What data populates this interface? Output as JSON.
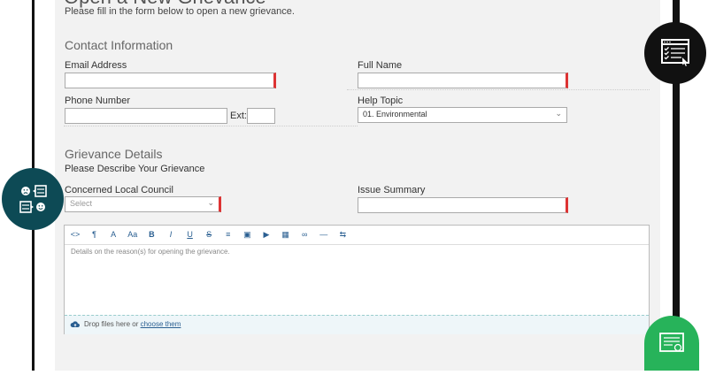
{
  "form": {
    "title": "Open a New Grievance",
    "subtitle": "Please fill in the form below to open a new grievance.",
    "contact_section": "Contact Information",
    "email_label": "Email Address",
    "fullname_label": "Full Name",
    "phone_label": "Phone Number",
    "ext_label": "Ext:",
    "help_topic_label": "Help Topic",
    "help_topic_value": "01. Environmental",
    "details_section": "Grievance Details",
    "details_prompt": "Please Describe Your Grievance",
    "council_label": "Concerned Local Council",
    "council_placeholder": "Select",
    "issue_label": "Issue Summary"
  },
  "editor": {
    "toolbar": [
      {
        "name": "code-view-icon",
        "glyph": "<>"
      },
      {
        "name": "paragraph-icon",
        "glyph": "¶"
      },
      {
        "name": "font-color-icon",
        "glyph": "A"
      },
      {
        "name": "font-size-icon",
        "glyph": "Aa"
      },
      {
        "name": "bold-icon",
        "glyph": "B"
      },
      {
        "name": "italic-icon",
        "glyph": "I"
      },
      {
        "name": "underline-icon",
        "glyph": "U"
      },
      {
        "name": "strikethrough-icon",
        "glyph": "S"
      },
      {
        "name": "list-icon",
        "glyph": "≡"
      },
      {
        "name": "image-icon",
        "glyph": "▣"
      },
      {
        "name": "video-icon",
        "glyph": "▶"
      },
      {
        "name": "table-icon",
        "glyph": "▦"
      },
      {
        "name": "link-icon",
        "glyph": "∞"
      },
      {
        "name": "horizontal-rule-icon",
        "glyph": "—"
      },
      {
        "name": "undo-redo-icon",
        "glyph": "⇆"
      }
    ],
    "placeholder": "Details on the reason(s) for opening the grievance.",
    "drop_text": "Drop files here or ",
    "drop_link": "choose them"
  },
  "colors": {
    "accent": "#2a5f91",
    "required": "#dd3333",
    "badge_dark": "#0d4a55",
    "badge_green": "#27b35a"
  }
}
